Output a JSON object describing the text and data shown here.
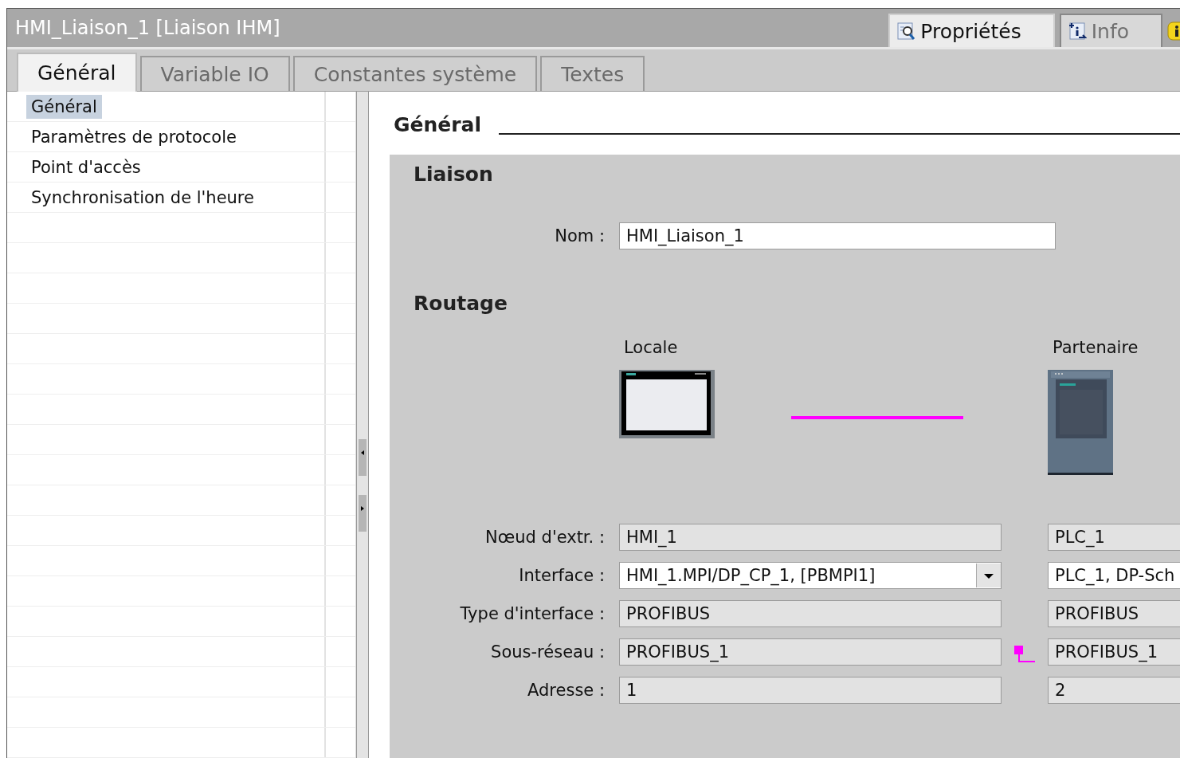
{
  "window": {
    "title": "HMI_Liaison_1 [Liaison IHM]"
  },
  "inspector_tabs": [
    {
      "label": "Propriétés",
      "selected": true
    },
    {
      "label": "Info",
      "selected": false
    }
  ],
  "tabs": [
    {
      "label": "Général",
      "selected": true
    },
    {
      "label": "Variable IO",
      "selected": false
    },
    {
      "label": "Constantes système",
      "selected": false
    },
    {
      "label": "Textes",
      "selected": false
    }
  ],
  "sidebar": {
    "items": [
      {
        "label": "Général",
        "selected": true
      },
      {
        "label": "Paramètres de protocole",
        "selected": false
      },
      {
        "label": "Point d'accès",
        "selected": false
      },
      {
        "label": "Synchronisation de l'heure",
        "selected": false
      }
    ]
  },
  "section_title": "Général",
  "connection": {
    "title": "Liaison",
    "name_label": "Nom :",
    "name_value": "HMI_Liaison_1"
  },
  "routing": {
    "title": "Routage",
    "local_title": "Locale",
    "partner_title": "Partenaire",
    "rows": [
      {
        "label": "Nœud d'extr. :",
        "local": "HMI_1",
        "local_editable": false,
        "kind": "text",
        "partner": "PLC_1",
        "partner_editable": false,
        "linked": false
      },
      {
        "label": "Interface :",
        "local": "HMI_1.MPI/DP_CP_1, [PBMPI1]",
        "local_editable": true,
        "kind": "dropdown",
        "partner": "PLC_1, DP-Sch",
        "partner_editable": true,
        "linked": false
      },
      {
        "label": "Type d'interface :",
        "local": "PROFIBUS",
        "local_editable": false,
        "kind": "text",
        "partner": "PROFIBUS",
        "partner_editable": false,
        "linked": false
      },
      {
        "label": "Sous-réseau :",
        "local": "PROFIBUS_1",
        "local_editable": false,
        "kind": "text",
        "partner": "PROFIBUS_1",
        "partner_editable": false,
        "linked": true
      },
      {
        "label": "Adresse :",
        "local": "1",
        "local_editable": false,
        "kind": "text",
        "partner": "2",
        "partner_editable": false,
        "linked": false
      }
    ]
  }
}
